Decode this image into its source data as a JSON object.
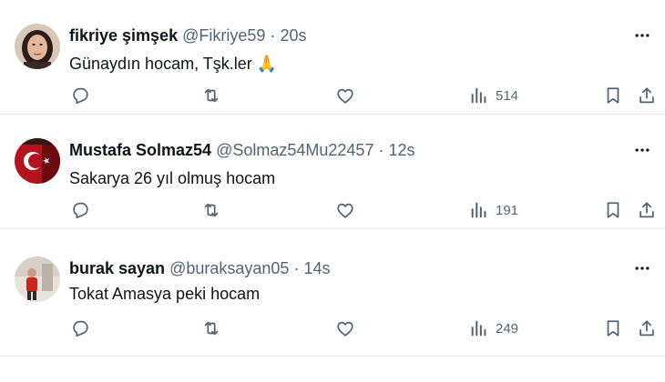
{
  "tweets": [
    {
      "name": "fikriye şimşek",
      "handle": "@Fikriye59",
      "dot": "·",
      "time": "20s",
      "text": "Günaydın hocam, Tşk.ler",
      "emoji": "🙏",
      "views": "514",
      "avatar_icon": "woman-portrait-avatar"
    },
    {
      "name": "Mustafa Solmaz54",
      "handle": "@Solmaz54Mu22457",
      "dot": "·",
      "time": "12s",
      "text": "Sakarya 26 yıl olmuş hocam",
      "emoji": "",
      "views": "191",
      "avatar_icon": "turkish-flag-avatar"
    },
    {
      "name": "burak sayan",
      "handle": "@buraksayan05",
      "dot": "·",
      "time": "14s",
      "text": "Tokat Amasya peki hocam",
      "emoji": "",
      "views": "249",
      "avatar_icon": "person-indoor-avatar"
    }
  ],
  "icons": {
    "reply": "reply-icon",
    "retweet": "retweet-icon",
    "like": "like-icon",
    "views": "views-icon",
    "bookmark": "bookmark-icon",
    "share": "share-icon",
    "more": "more-icon"
  },
  "colors": {
    "text": "#0f1419",
    "secondary": "#536471",
    "divider": "#e6e9ec"
  }
}
